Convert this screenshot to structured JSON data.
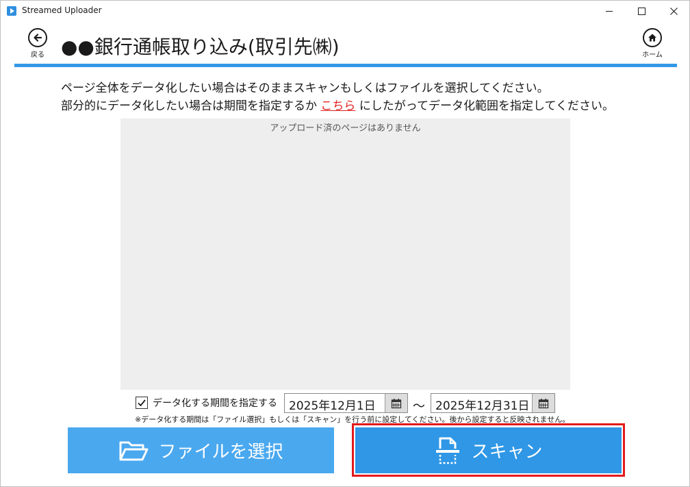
{
  "window": {
    "title": "Streamed Uploader"
  },
  "header": {
    "back_label": "戻る",
    "home_label": "ホーム",
    "title": "●●銀行通帳取り込み(取引先㈱)"
  },
  "instructions": {
    "line1": "ページ全体をデータ化したい場合はそのままスキャンもしくはファイルを選択してください。",
    "line2_before": "部分的にデータ化したい場合は期間を指定するか",
    "line2_link": "こちら",
    "line2_after": "にしたがってデータ化範囲を指定してください。"
  },
  "preview": {
    "empty_message": "アップロード済のページはありません"
  },
  "period": {
    "checked": true,
    "label": "データ化する期間を指定する",
    "start_date": "2025年12月1日",
    "separator": "～",
    "end_date": "2025年12月31日",
    "note": "※データ化する期間は「ファイル選択」もしくは「スキャン」を行う前に設定してください。後から設定すると反映されません。"
  },
  "actions": {
    "select_file_label": "ファイルを選択",
    "scan_label": "スキャン"
  },
  "colors": {
    "accent": "#3399e6",
    "file_button": "#4aa8ef",
    "scan_button": "#2f97e6",
    "highlight": "#e3191b",
    "link": "#e02020"
  },
  "icons": {
    "back": "arrow-left-circle-icon",
    "home": "home-circle-icon",
    "calendar": "calendar-icon",
    "folder": "folder-open-icon",
    "scanner": "scanner-icon"
  }
}
